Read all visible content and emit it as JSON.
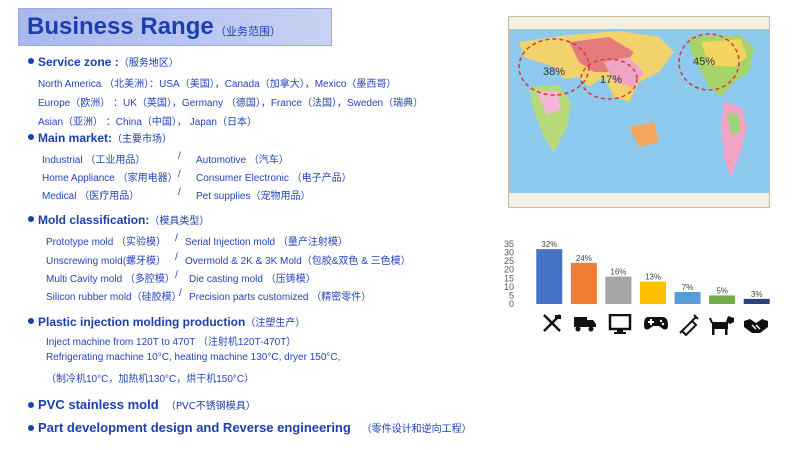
{
  "title": {
    "main": "Business Range",
    "sub": "（业务范围）"
  },
  "service_zone": {
    "heading": "Service zone :",
    "heading_zh": "（服务地区）",
    "lines": [
      "North America （北美洲）：USA（美国），Canada（加拿大），Mexico（墨西哥）",
      "Europe（欧洲）  ：UK（英国），Germany （德国），France（法国），Sweden（瑞典）",
      "Asian（亚洲）  ：China（中国），  Japan（日本）"
    ]
  },
  "main_market": {
    "heading": "Main market:",
    "heading_zh": "（主要市场）",
    "rows": [
      {
        "left": "Industrial （工业用品）",
        "sep": "/",
        "right": "Automotive （汽车）"
      },
      {
        "left": "Home Appliance （家用电器）",
        "sep": "/",
        "right": "Consumer Electronic （电子产品）"
      },
      {
        "left": "Medical  （医疗用品）",
        "sep": "/",
        "right": "Pet supplies（宠物用品）"
      }
    ]
  },
  "mold_classification": {
    "heading": "Mold classification:",
    "heading_zh": "（模具类型）",
    "rows": [
      {
        "left": "Prototype mold （实验模）",
        "sep": "/",
        "right": "Serial Injection mold （量产注射模）"
      },
      {
        "left": "Unscrewing mold(螺牙模）",
        "sep": "/",
        "right": "Overmold & 2K & 3K Mold（包胶&双色 & 三色模）"
      },
      {
        "left": "Multi Cavity mold （多腔模）",
        "sep": "/",
        "right": "Die casting mold （压铸模）"
      },
      {
        "left": "Silicon rubber mold（硅胶模）",
        "sep": "/",
        "right": "Precision parts customized （精密零件）"
      }
    ]
  },
  "plastic_injection": {
    "heading": "Plastic injection molding production",
    "heading_zh": "（注塑生产）",
    "lines": [
      "Inject machine from 120T to 470T （注射机120T-470T）",
      "Refrigerating machine 10°C, heating machine 130°C, dryer 150°C,",
      "（制冷机10°C，加热机130°C，烘干机150°C）"
    ]
  },
  "pvc": {
    "heading": "PVC stainless mold",
    "heading_zh": "（PVC不锈钢模具）"
  },
  "part_dev": {
    "heading": "Part development design and Reverse engineering",
    "heading_zh": "（零件设计和逆向工程）"
  },
  "map": {
    "labels": [
      "38%",
      "17%",
      "45%"
    ]
  },
  "chart_data": {
    "type": "bar",
    "categories": [
      "Industrial",
      "Automotive",
      "Home Appliance",
      "Consumer Electronic",
      "Medical",
      "Pet supplies",
      "Other"
    ],
    "values": [
      32,
      24,
      16,
      13,
      7,
      5,
      3
    ],
    "data_labels": [
      "32%",
      "24%",
      "16%",
      "13%",
      "7%",
      "5%",
      "3%"
    ],
    "yticks": [
      "0",
      "5",
      "10",
      "15",
      "20",
      "25",
      "30",
      "35"
    ],
    "ylim": [
      0,
      35
    ],
    "colors": [
      "#4472c4",
      "#ed7d31",
      "#a5a5a5",
      "#ffc000",
      "#5b9bd5",
      "#70ad47",
      "#264478"
    ],
    "icons": [
      "tools-icon",
      "truck-icon",
      "monitor-icon",
      "gamepad-icon",
      "syringe-icon",
      "dog-icon",
      "handshake-icon"
    ]
  }
}
